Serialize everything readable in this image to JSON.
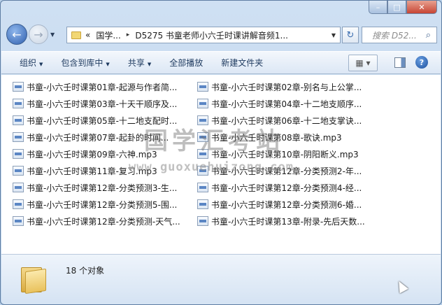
{
  "window": {
    "minimize": "–",
    "maximize": "□",
    "close": "✕"
  },
  "address": {
    "overflow": "«",
    "seg1": "国学...",
    "sep": "▸",
    "seg2": "D5275 书童老师小六壬时课讲解音频1..."
  },
  "search": {
    "placeholder": "搜索 D52..."
  },
  "toolbar": {
    "organize": "组织",
    "include": "包含到库中",
    "share": "共享",
    "playall": "全部播放",
    "newfolder": "新建文件夹"
  },
  "files": [
    "书童-小六壬时课第01章-起源与作者简...",
    "书童-小六壬时课第03章-十天干顺序及...",
    "书童-小六壬时课第05章-十二地支配时...",
    "书童-小六壬时课第07章-起卦的时间...",
    "书童-小六壬时课第09章-六神.mp3",
    "书童-小六壬时课第11章-复习.mp3",
    "书童-小六壬时课第12章-分类预测3-生...",
    "书童-小六壬时课第12章-分类预测5-围...",
    "书童-小六壬时课第12章-分类预测-天气...",
    "书童-小六壬时课第02章-别名与上公掌...",
    "书童-小六壬时课第04章-十二地支顺序...",
    "书童-小六壬时课第06章-十二地支掌诀...",
    "书童-小六壬时课第08章-歌诀.mp3",
    "书童-小六壬时课第10章-阴阳断义.mp3",
    "书童-小六壬时课第12章-分类预测2-年...",
    "书童-小六壬时课第12章-分类预测4-经...",
    "书童-小六壬时课第12章-分类预测6-婚...",
    "书童-小六壬时课第13章-附录-先后天数..."
  ],
  "watermark": {
    "cn": "国学汇考站",
    "url": "www.guoxuehuizong.com"
  },
  "status": {
    "count": "18 个对象"
  }
}
